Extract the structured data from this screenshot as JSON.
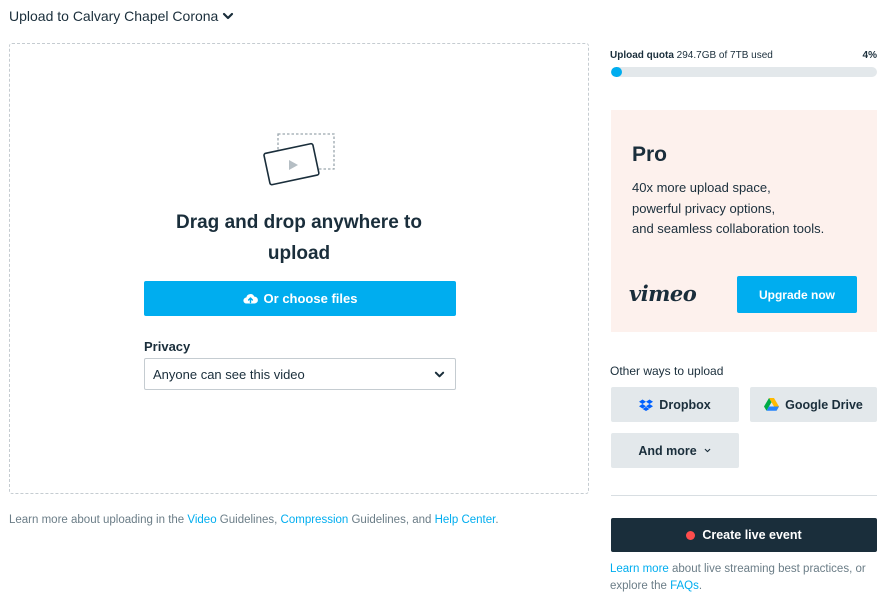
{
  "header": {
    "title": "Upload to Calvary Chapel Corona"
  },
  "dropzone": {
    "title_line1": "Drag and drop anywhere to",
    "title_line2": "upload",
    "choose_label": "Or choose files",
    "privacy_label": "Privacy",
    "privacy_value": "Anyone can see this video"
  },
  "footer": {
    "prefix": "Learn more about uploading in the ",
    "link_video": "Video",
    "text_guidelines1": " Guidelines, ",
    "link_compression": "Compression",
    "text_guidelines2": " Guidelines, and ",
    "link_help": "Help Center",
    "suffix": "."
  },
  "quota": {
    "label": "Upload quota",
    "used_text": "294.7GB of 7TB used",
    "percent_text": "4%",
    "fill_fraction": 0.04
  },
  "pro": {
    "title": "Pro",
    "desc_line1": "40x more upload space,",
    "desc_line2": "powerful privacy options,",
    "desc_line3": "and seamless collaboration tools.",
    "logo_text": "vimeo",
    "upgrade_label": "Upgrade now"
  },
  "other": {
    "label": "Other ways to upload",
    "dropbox_label": "Dropbox",
    "gdrive_label": "Google Drive",
    "more_label": "And more"
  },
  "live": {
    "button_label": "Create live event",
    "note_link1": "Learn more",
    "note_text1": " about live streaming best practices, or explore the ",
    "note_link2": "FAQs",
    "note_suffix": "."
  },
  "colors": {
    "accent": "#00adef",
    "dark": "#1a2e3b",
    "pro_bg": "#fdf1ed",
    "live_dot": "#ff4d4d"
  }
}
